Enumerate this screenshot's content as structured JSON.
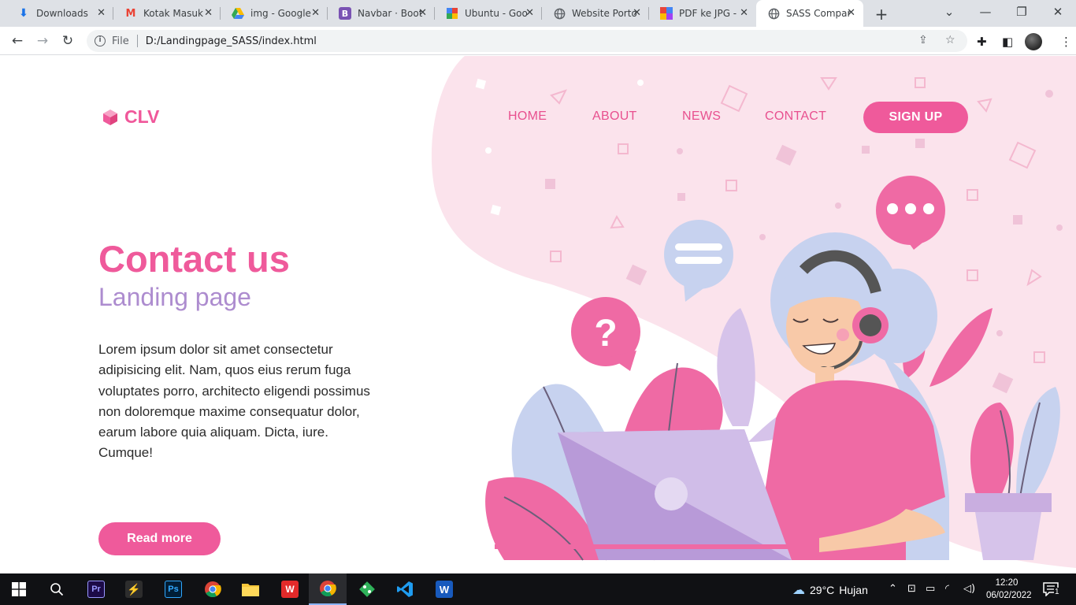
{
  "browser": {
    "tabs": [
      {
        "title": "Downloads",
        "icon": "download-icon",
        "color": "#1a73e8"
      },
      {
        "title": "Kotak Masuk",
        "icon": "gmail-icon",
        "color": "#ea4335"
      },
      {
        "title": "img - Google",
        "icon": "google-drive-icon",
        "color": "#34a853"
      },
      {
        "title": "Navbar · Boot",
        "icon": "bootstrap-icon",
        "color": "#7952b3"
      },
      {
        "title": "Ubuntu - Goo",
        "icon": "google-slides-icon",
        "color": "#fbbc04"
      },
      {
        "title": "Website Porto",
        "icon": "globe-icon",
        "color": "#5f6368"
      },
      {
        "title": "PDF ke JPG -",
        "icon": "pdf-tool-icon",
        "color": "#e8453c"
      },
      {
        "title": "SASS Compan",
        "icon": "globe-icon",
        "color": "#5f6368"
      }
    ],
    "active_tab": 7,
    "address": {
      "scheme_label": "File",
      "url": "D:/Landingpage_SASS/index.html"
    }
  },
  "site": {
    "logo": "CLV",
    "nav": [
      "HOME",
      "ABOUT",
      "NEWS",
      "CONTACT"
    ],
    "signup": "SIGN UP",
    "hero": {
      "title": "Contact us",
      "subtitle": "Landing page",
      "body": "Lorem ipsum dolor sit amet consectetur adipisicing elit. Nam, quos eius rerum fuga voluptates porro, architecto eligendi possimus non doloremque maxime consequatur dolor, earum labore quia aliquam. Dicta, iure. Cumque!",
      "cta": "Read more"
    },
    "colors": {
      "primary": "#ef5a9b",
      "secondary": "#ad8ccf",
      "background_blob": "#fbe3ec"
    }
  },
  "taskbar": {
    "apps": [
      "windows-start-icon",
      "search-icon",
      "premiere-pro-icon",
      "app-icon",
      "photoshop-icon",
      "chrome-icon",
      "file-explorer-icon",
      "wps-office-icon",
      "chrome-icon",
      "git-icon",
      "vscode-icon",
      "word-icon"
    ],
    "weather": {
      "temp": "29°C",
      "condition": "Hujan"
    },
    "time": "12:20",
    "date": "06/02/2022",
    "notification_count": "1"
  }
}
